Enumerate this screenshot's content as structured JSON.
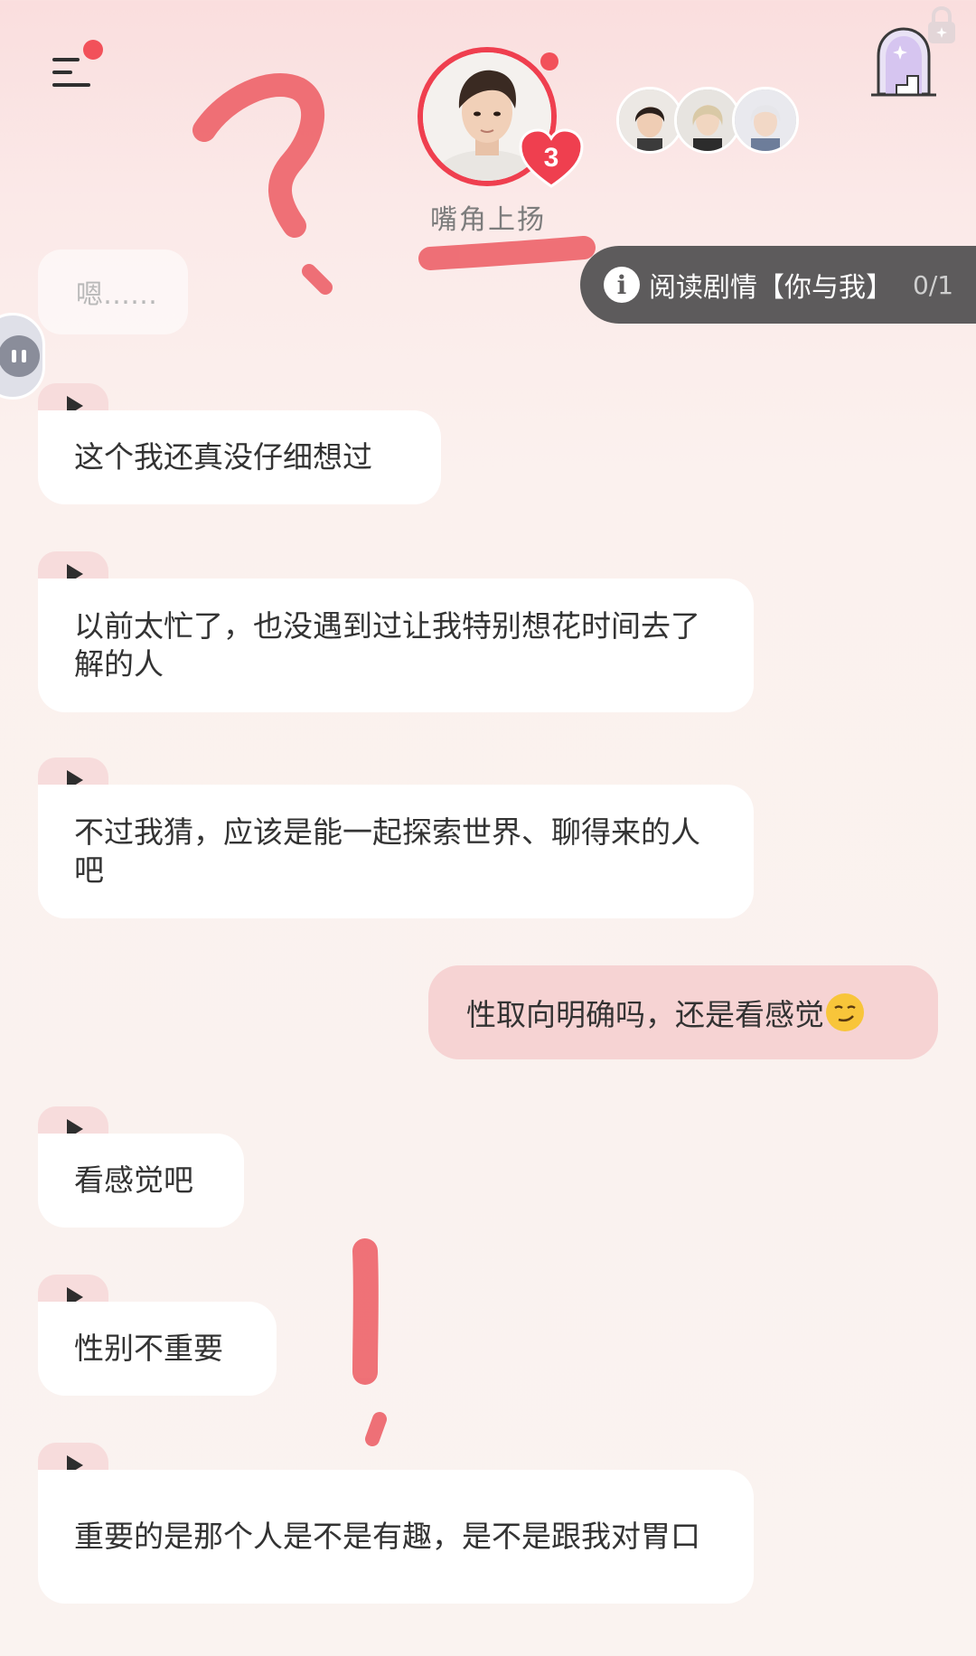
{
  "header": {
    "character_name": "嘴角上扬",
    "heart_count": "3",
    "menu_icon": "menu-icon",
    "portal_icon": "arch-door-icon",
    "lock_icon": "lock-icon",
    "other_characters": [
      "character-1",
      "character-2",
      "character-3"
    ]
  },
  "story_pill": {
    "label": "阅读剧情【你与我】",
    "count": "0/1"
  },
  "faded_message": "嗯……",
  "messages": [
    {
      "role": "character",
      "text": "这个我还真没仔细想过"
    },
    {
      "role": "character",
      "text": "以前太忙了，也没遇到过让我特别想花时间去了解的人"
    },
    {
      "role": "character",
      "text": "不过我猜，应该是能一起探索世界、聊得来的人吧"
    },
    {
      "role": "user",
      "text": "性取向明确吗，还是看感觉"
    },
    {
      "role": "character",
      "text": "看感觉吧"
    },
    {
      "role": "character",
      "text": "性别不重要"
    },
    {
      "role": "character",
      "text": "重要的是那个人是不是有趣，是不是跟我对胃口"
    }
  ],
  "colors": {
    "accent": "#ef3f4f",
    "user_bubble": "#f6d3d3",
    "character_bubble": "#ffffff",
    "pill": "#5d5b5c",
    "scribble": "#ec5a62"
  }
}
